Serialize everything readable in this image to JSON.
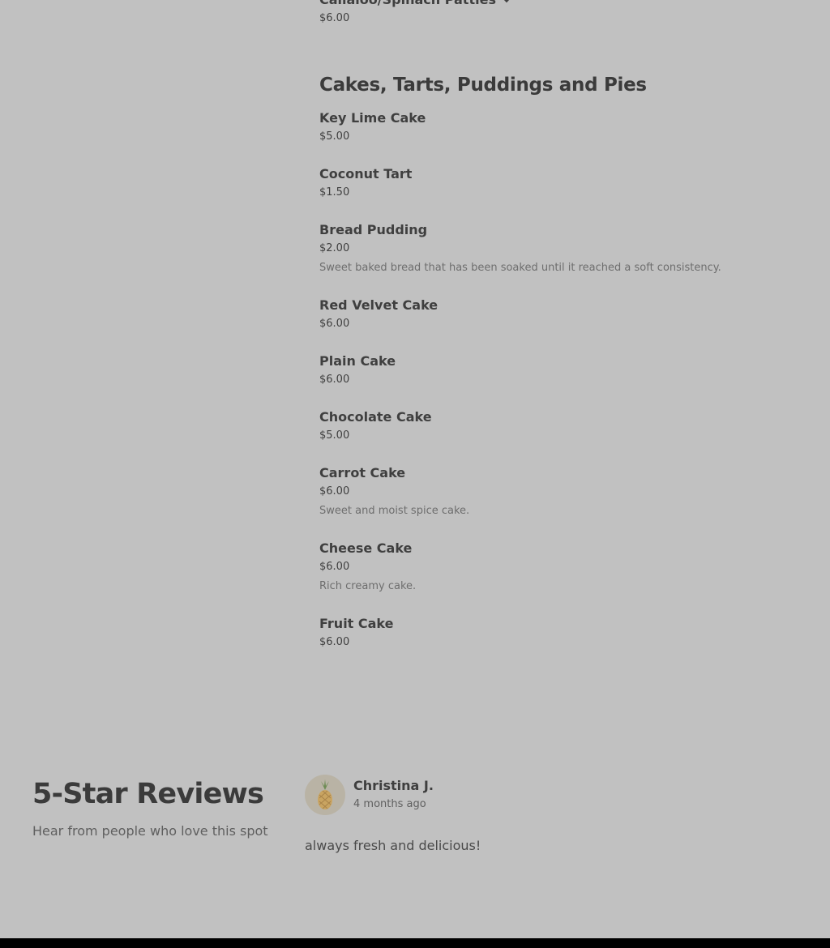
{
  "top_item": {
    "name": "Callaloo/Spinach Patties",
    "price": "$6.00"
  },
  "section": {
    "title": "Cakes, Tarts, Puddings and Pies",
    "items": [
      {
        "name": "Key Lime Cake",
        "price": "$5.00"
      },
      {
        "name": "Coconut Tart",
        "price": "$1.50"
      },
      {
        "name": "Bread Pudding",
        "price": "$2.00",
        "description": "Sweet baked bread that has been soaked until it reached a soft consistency."
      },
      {
        "name": "Red Velvet Cake",
        "price": "$6.00"
      },
      {
        "name": "Plain Cake",
        "price": "$6.00"
      },
      {
        "name": "Chocolate Cake",
        "price": "$5.00"
      },
      {
        "name": "Carrot Cake",
        "price": "$6.00",
        "description": "Sweet and moist spice cake."
      },
      {
        "name": "Cheese Cake",
        "price": "$6.00",
        "description": "Rich creamy cake."
      },
      {
        "name": "Fruit Cake",
        "price": "$6.00"
      }
    ]
  },
  "reviews": {
    "title": "5-Star Reviews",
    "subtitle": "Hear from people who love this spot",
    "items": [
      {
        "name": "Christina J.",
        "time": "4 months ago",
        "text": "always fresh and delicious!",
        "avatar_icon": "pineapple-icon"
      }
    ]
  },
  "colors": {
    "background": "#c1c1c1",
    "footer": "#000000"
  }
}
